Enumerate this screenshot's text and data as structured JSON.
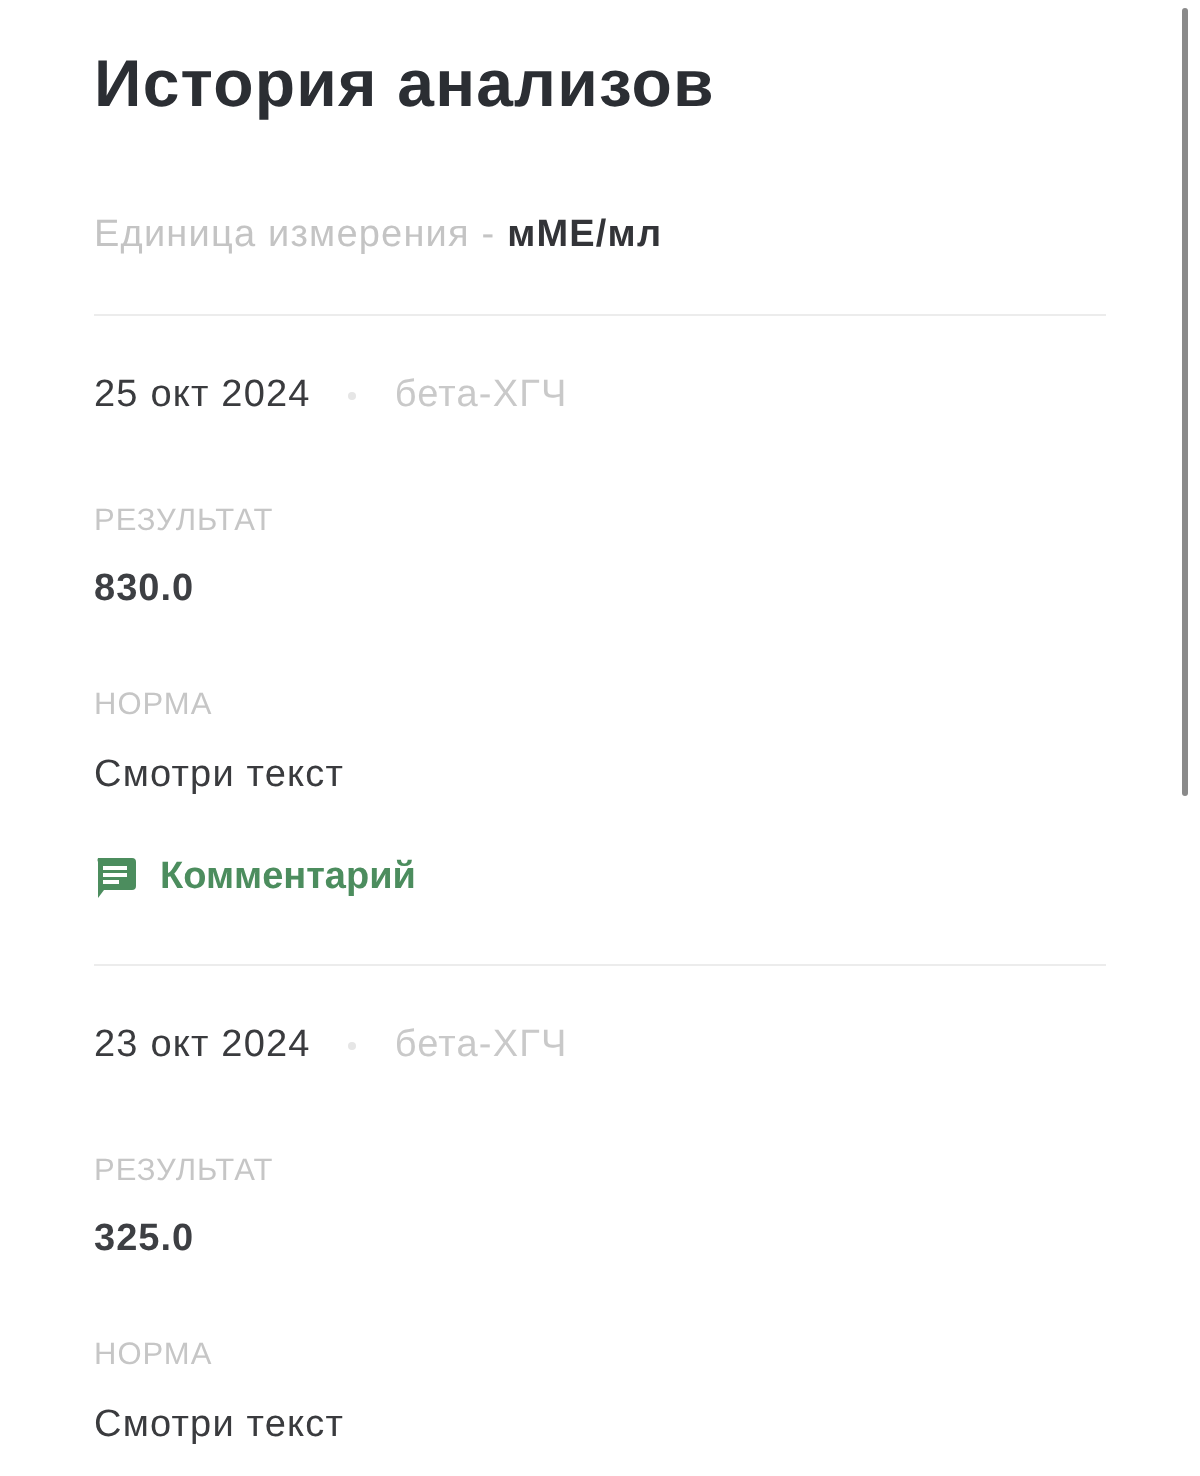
{
  "title": "История анализов",
  "unit_line": "Единица измерения - **мМЕ/мл**",
  "entries": [
    {
      "date": "25 окт 2024",
      "test": "бета-ХГЧ",
      "result_label": "РЕЗУЛЬТАТ",
      "result": "830.0",
      "norm_label": "НОРМА",
      "norm": "Смотри текст",
      "comment_link": "Комментарий"
    },
    {
      "date": "23 окт 2024",
      "test": "бета-ХГЧ",
      "result_label": "РЕЗУЛЬТАТ",
      "result": "325.0",
      "norm_label": "НОРМА",
      "norm": "Смотри текст"
    }
  ]
}
